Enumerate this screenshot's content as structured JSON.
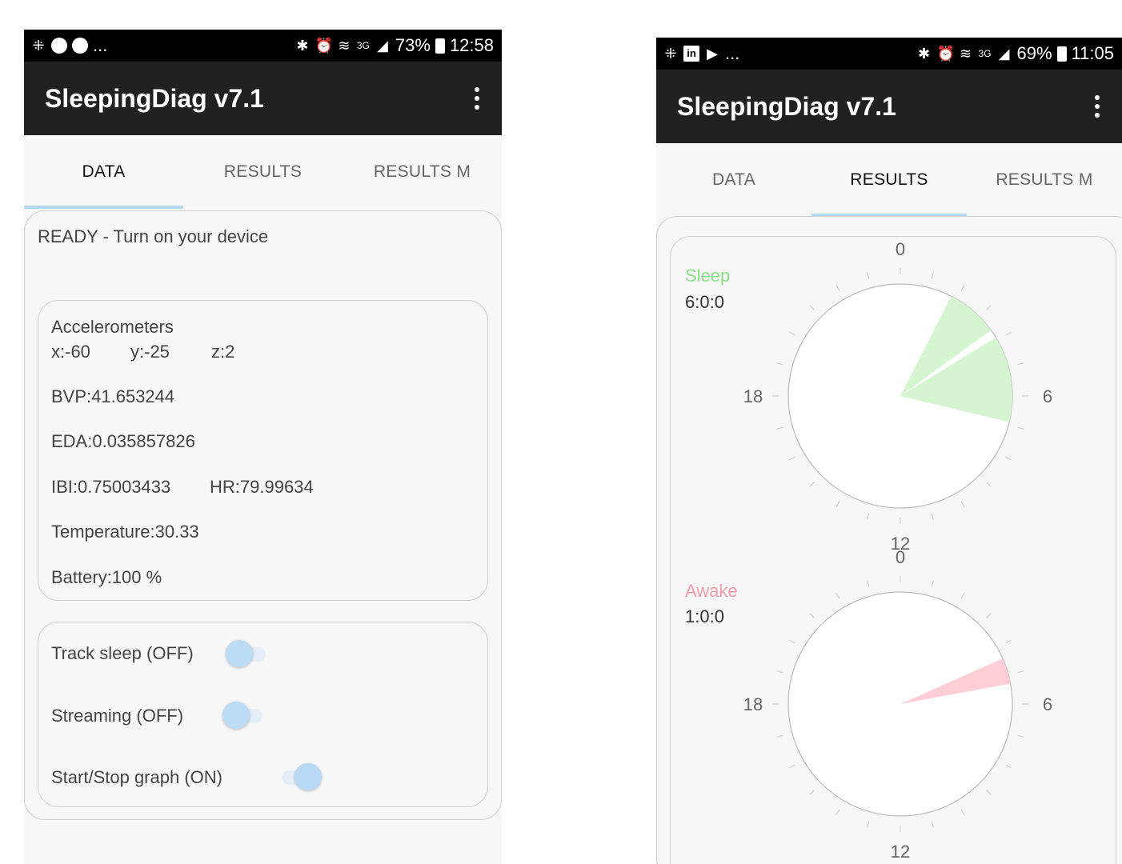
{
  "left": {
    "status": {
      "extra": "...",
      "battery": "73%",
      "time": "12:58",
      "network": "3G"
    },
    "app_title": "SleepingDiag v7.1",
    "tabs": [
      "DATA",
      "RESULTS",
      "RESULTS M"
    ],
    "active_tab": 0,
    "status_message": "READY - Turn on your device",
    "sensors": {
      "accel_title": "Accelerometers",
      "x": "x:-60",
      "y": "y:-25",
      "z": "z:2",
      "bvp": "BVP:41.653244",
      "eda": "EDA:0.035857826",
      "ibi": "IBI:0.75003433",
      "hr": "HR:79.99634",
      "temperature": "Temperature:30.33",
      "battery": "Battery:100 %"
    },
    "controls": [
      {
        "label": "Track sleep (OFF)",
        "on": false
      },
      {
        "label": "Streaming (OFF)",
        "on": false
      },
      {
        "label": "Start/Stop graph (ON)",
        "on": true
      }
    ]
  },
  "right": {
    "status": {
      "extra": "...",
      "battery": "69%",
      "time": "11:05",
      "network": "3G"
    },
    "app_title": "SleepingDiag v7.1",
    "tabs": [
      "DATA",
      "RESULTS",
      "RESULTS M"
    ],
    "active_tab": 1,
    "colors": {
      "sleep": "#d4f5d0",
      "sleep_label": "#8ddf86",
      "awake": "#ffcdd6",
      "awake_label": "#f29bab"
    },
    "sleep": {
      "label": "Sleep",
      "duration": "6:0:0",
      "hour_labels": [
        "0",
        "6",
        "12",
        "18"
      ],
      "segments_hours": [
        [
          1.8,
          3.6
        ],
        [
          3.9,
          6.9
        ]
      ]
    },
    "awake": {
      "label": "Awake",
      "duration": "1:0:0",
      "hour_labels": [
        "0",
        "6",
        "12",
        "18"
      ],
      "segments_hours": [
        [
          4.4,
          5.3
        ]
      ]
    }
  }
}
